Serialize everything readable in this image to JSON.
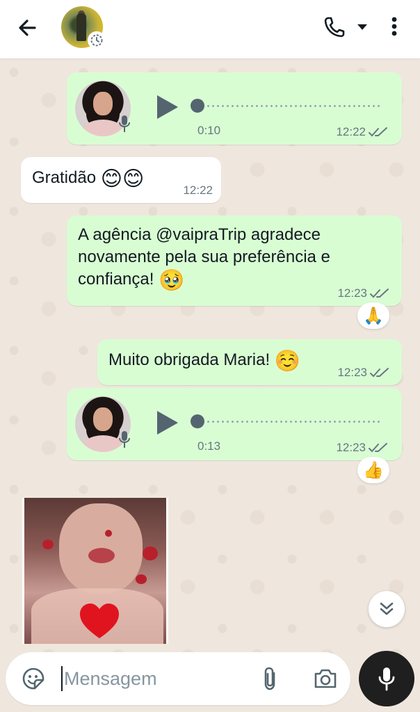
{
  "header": {
    "back_icon": "arrow-left-icon",
    "contact_avatar": "contact-avatar",
    "status_icon": "status-timer-icon",
    "call_icon": "phone-icon",
    "call_menu_icon": "caret-down-icon",
    "menu_icon": "more-vertical-icon"
  },
  "messages": [
    {
      "type": "voice",
      "direction": "out",
      "duration": "0:10",
      "time": "12:22"
    },
    {
      "type": "text",
      "direction": "in",
      "text": "Gratidão",
      "emoji": "😊😊",
      "time": "12:22"
    },
    {
      "type": "text",
      "direction": "out",
      "text": "A agência @vaipraTrip agradece novamente pela sua preferência e confiança!",
      "emoji": "🥹",
      "time": "12:23",
      "reaction": "🙏"
    },
    {
      "type": "text",
      "direction": "out",
      "text": "Muito obrigada Maria!",
      "emoji": "☺️",
      "time": "12:23"
    },
    {
      "type": "voice",
      "direction": "out",
      "duration": "0:13",
      "time": "12:23",
      "reaction": "👍"
    },
    {
      "type": "sticker",
      "direction": "in"
    }
  ],
  "composer": {
    "placeholder": "Mensagem",
    "sticker_icon": "sticker-icon",
    "attach_icon": "paperclip-icon",
    "camera_icon": "camera-icon",
    "mic_icon": "microphone-icon"
  },
  "scroll_icon": "double-chevron-down-icon",
  "colors": {
    "outgoing_bubble": "#d9fdd3",
    "incoming_bubble": "#ffffff",
    "chat_background": "#efe7de",
    "tick": "#667781"
  }
}
